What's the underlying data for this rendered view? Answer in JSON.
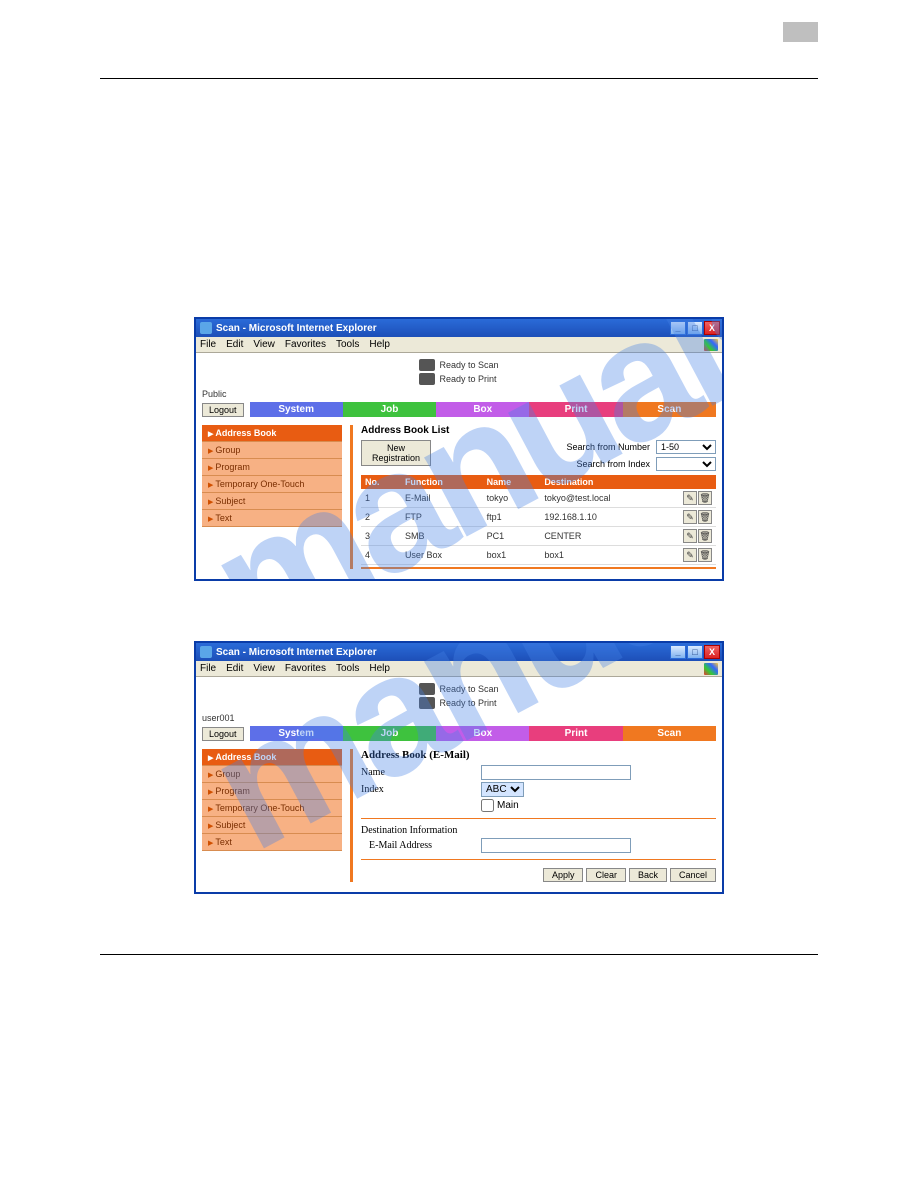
{
  "watermark": "manualshive.com",
  "shot1": {
    "title": "Scan - Microsoft Internet Explorer",
    "menu": [
      "File",
      "Edit",
      "View",
      "Favorites",
      "Tools",
      "Help"
    ],
    "status": {
      "scan": "Ready to Scan",
      "print": "Ready to Print"
    },
    "user": "Public",
    "logout": "Logout",
    "tabs": {
      "system": "System",
      "job": "Job",
      "box": "Box",
      "print": "Print",
      "scan": "Scan"
    },
    "sidebar": {
      "addressbook": "Address Book",
      "group": "Group",
      "program": "Program",
      "temp": "Temporary One-Touch",
      "subject": "Subject",
      "text": "Text"
    },
    "list": {
      "heading": "Address Book List",
      "newreg": "New Registration",
      "searchNumLabel": "Search from Number",
      "searchNumValue": "1-50",
      "searchIdxLabel": "Search from Index",
      "cols": {
        "no": "No.",
        "func": "Function",
        "name": "Name",
        "dest": "Destination"
      },
      "rows": [
        {
          "no": "1",
          "func": "E-Mail",
          "name": "tokyo",
          "dest": "tokyo@test.local"
        },
        {
          "no": "2",
          "func": "FTP",
          "name": "ftp1",
          "dest": "192.168.1.10"
        },
        {
          "no": "3",
          "func": "SMB",
          "name": "PC1",
          "dest": "CENTER"
        },
        {
          "no": "4",
          "func": "User Box",
          "name": "box1",
          "dest": "box1"
        }
      ]
    }
  },
  "shot2": {
    "title": "Scan - Microsoft Internet Explorer",
    "menu": [
      "File",
      "Edit",
      "View",
      "Favorites",
      "Tools",
      "Help"
    ],
    "status": {
      "scan": "Ready to Scan",
      "print": "Ready to Print"
    },
    "user": "user001",
    "logout": "Logout",
    "tabs": {
      "system": "System",
      "job": "Job",
      "box": "Box",
      "print": "Print",
      "scan": "Scan"
    },
    "sidebar": {
      "addressbook": "Address Book",
      "group": "Group",
      "program": "Program",
      "temp": "Temporary One-Touch",
      "subject": "Subject",
      "text": "Text"
    },
    "form": {
      "heading": "Address Book (E-Mail)",
      "nameLabel": "Name",
      "indexLabel": "Index",
      "indexValue": "ABC",
      "mainLabel": "Main",
      "destHeading": "Destination Information",
      "emailLabel": "E-Mail Address",
      "buttons": {
        "apply": "Apply",
        "clear": "Clear",
        "back": "Back",
        "cancel": "Cancel"
      }
    }
  }
}
